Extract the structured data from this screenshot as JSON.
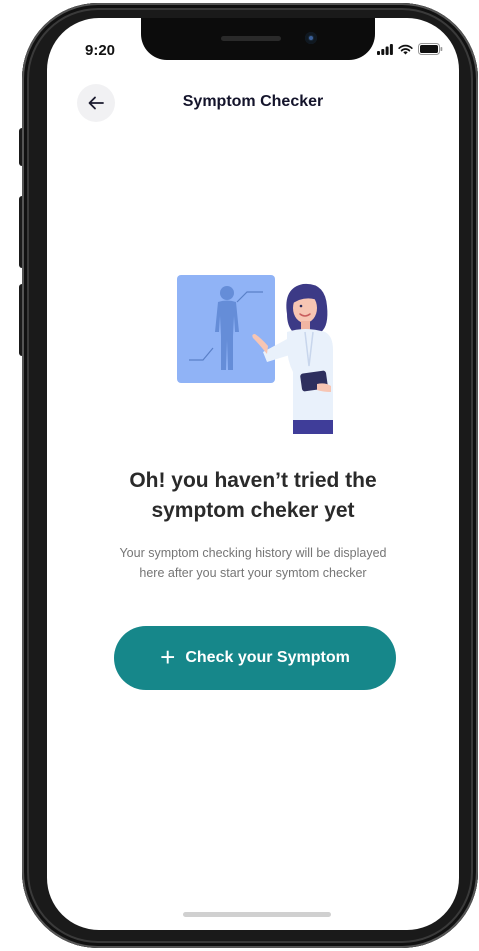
{
  "status_bar": {
    "time": "9:20"
  },
  "header": {
    "title": "Symptom Checker"
  },
  "empty_state": {
    "title_line1": "Oh! you haven’t tried the",
    "title_line2": "symptom cheker yet",
    "description_line1": "Your symptom checking history will be displayed",
    "description_line2": "here after you start your symtom checker"
  },
  "cta": {
    "label": "Check your Symptom"
  },
  "colors": {
    "accent": "#16878a",
    "panel": "#90b3f6",
    "title": "#14142b"
  }
}
